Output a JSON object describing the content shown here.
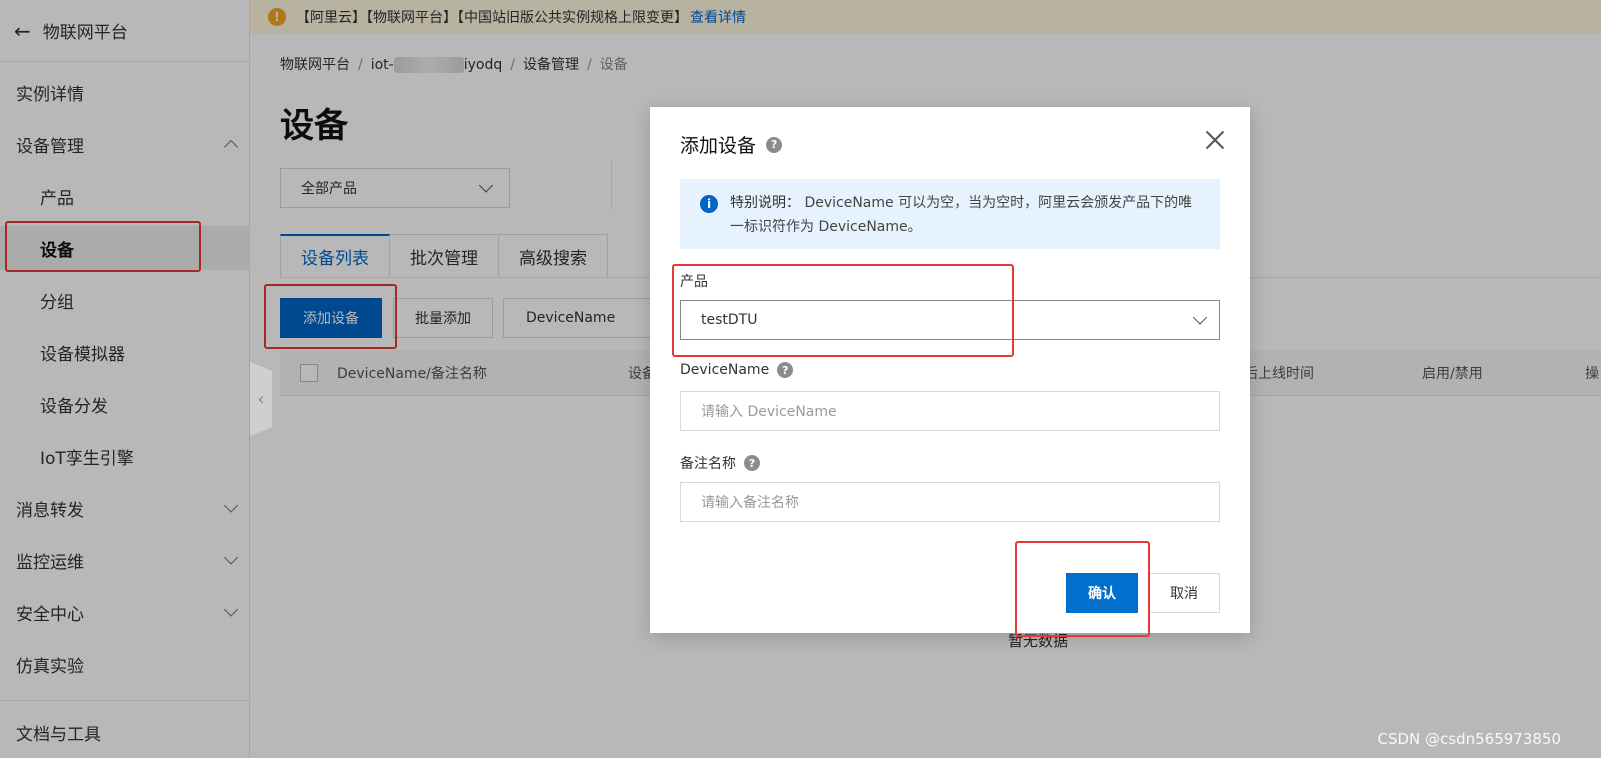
{
  "colors": {
    "accent": "#0064c8",
    "highlight": "#e53935",
    "notice_bg": "#e6f2fd",
    "banner_bg": "#fff7df"
  },
  "sidebar": {
    "back_label": "物联网平台",
    "items": [
      {
        "label": "实例详情"
      },
      {
        "label": "设备管理"
      },
      {
        "label": "产品"
      },
      {
        "label": "设备"
      },
      {
        "label": "分组"
      },
      {
        "label": "设备模拟器"
      },
      {
        "label": "设备分发"
      },
      {
        "label": "IoT孪生引擎"
      },
      {
        "label": "消息转发"
      },
      {
        "label": "监控运维"
      },
      {
        "label": "安全中心"
      },
      {
        "label": "仿真实验"
      },
      {
        "label": "文档与工具"
      }
    ]
  },
  "banner": {
    "text": "【阿里云】【物联网平台】【中国站旧版公共实例规格上限变更】",
    "link": "查看详情"
  },
  "breadcrumb": {
    "root": "物联网平台",
    "instance_prefix": "iot-",
    "instance_suffix": "iyodq",
    "section": "设备管理",
    "current": "设备"
  },
  "page": {
    "title": "设备",
    "product_filter": "全部产品",
    "tabs": [
      "设备列表",
      "批次管理",
      "高级搜索"
    ],
    "add_button": "添加设备",
    "batch_add_button": "批量添加",
    "search_field": "DeviceName",
    "table_headers": [
      "DeviceName/备注名称",
      "设备",
      "最后上线时间",
      "启用/禁用",
      "操"
    ],
    "empty_text": "暂无数据"
  },
  "modal": {
    "title": "添加设备",
    "notice_label": "特别说明：",
    "notice_text": "DeviceName 可以为空，当为空时，阿里云会颁发产品下的唯一标识符作为 DeviceName。",
    "product_label": "产品",
    "product_value": "testDTU",
    "devicename_label": "DeviceName",
    "devicename_placeholder": "请输入 DeviceName",
    "remark_label": "备注名称",
    "remark_placeholder": "请输入备注名称",
    "confirm": "确认",
    "cancel": "取消"
  },
  "watermark": "CSDN @csdn565973850"
}
